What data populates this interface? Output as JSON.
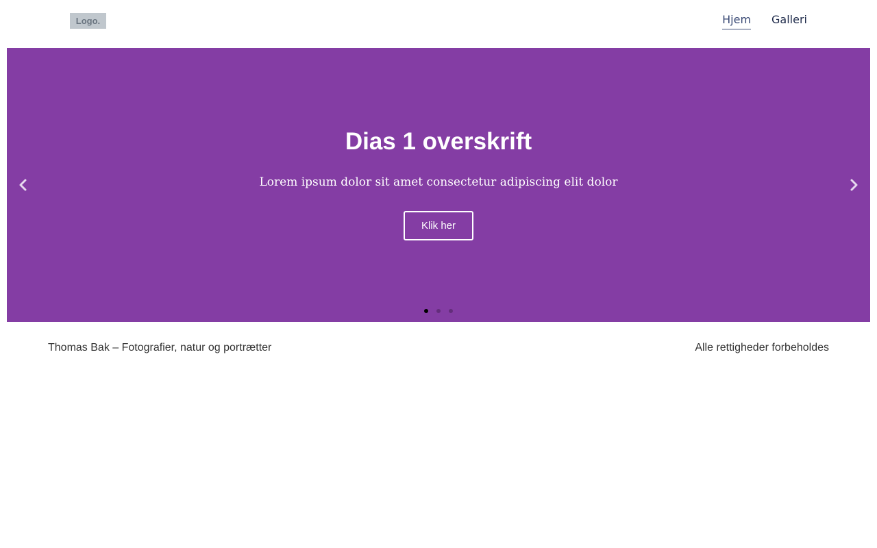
{
  "header": {
    "logo_text": "Logo.",
    "nav": [
      {
        "label": "Hjem",
        "active": true
      },
      {
        "label": "Galleri",
        "active": false
      }
    ]
  },
  "slider": {
    "background_color": "#843da4",
    "title": "Dias 1 overskrift",
    "text": "Lorem ipsum dolor sit amet consectetur adipiscing elit dolor",
    "button_label": "Klik her",
    "prev_icon": "chevron-left-icon",
    "next_icon": "chevron-right-icon",
    "slide_count": 3,
    "active_slide": 1
  },
  "footer": {
    "left_text": "Thomas Bak – Fotografier, natur og portrætter",
    "right_text": "Alle rettigheder forbeholdes"
  }
}
